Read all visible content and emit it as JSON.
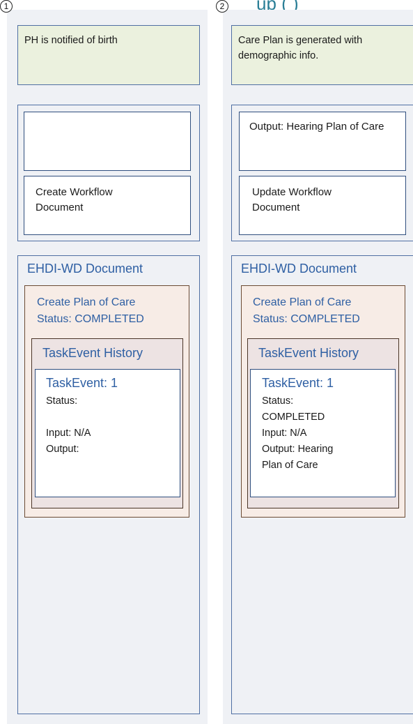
{
  "header_partial": "up (   )",
  "steps": [
    {
      "number": "1",
      "event_text": "PH is notified of birth",
      "output_text": "",
      "workflow_text": "Create Workflow Document",
      "doc_title": "EHDI-WD Document",
      "plan_title": "Create Plan of Care",
      "plan_status": "Status: COMPLETED",
      "history_title": "TaskEvent History",
      "task_title": "TaskEvent: 1",
      "task_status": "Status:",
      "task_status_value": "",
      "task_input": "Input:  N/A",
      "task_output": "Output:",
      "task_output_value": ""
    },
    {
      "number": "2",
      "event_text": "Care Plan is generated with demographic info.",
      "output_text": "Output:  Hearing Plan of Care",
      "workflow_text": "Update Workflow Document",
      "doc_title": "EHDI-WD Document",
      "plan_title": "Create Plan of Care",
      "plan_status": "Status: COMPLETED",
      "history_title": "TaskEvent History",
      "task_title": "TaskEvent: 1",
      "task_status": "Status:",
      "task_status_value": "COMPLETED",
      "task_input": "Input:  N/A",
      "task_output": "Output:  Hearing",
      "task_output_value": "Plan of Care"
    }
  ],
  "colors": {
    "panel_bg": "#eff1f5",
    "event_box": "#ebf1de",
    "plan_box": "#f7ece6",
    "history_box": "#ede3e3",
    "title_blue": "#2e5fa3"
  }
}
